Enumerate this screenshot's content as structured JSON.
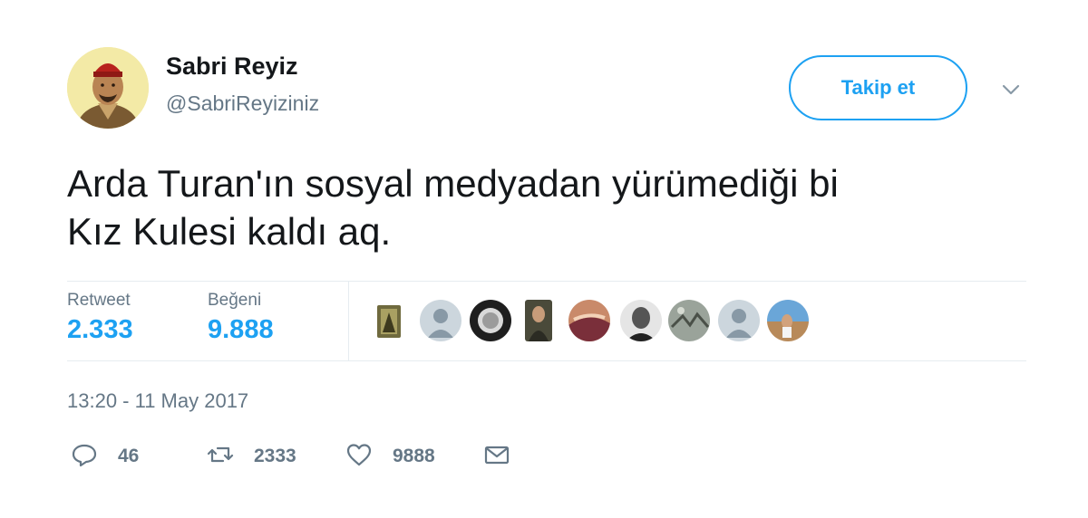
{
  "user": {
    "display_name": "Sabri Reyiz",
    "handle": "@SabriReyiziniz"
  },
  "follow_label": "Takip et",
  "tweet": {
    "text": "Arda Turan'ın sosyal medyadan yürümediği bi\nKız Kulesi kaldı aq."
  },
  "stats": {
    "retweets_label": "Retweet",
    "retweets_value": "2.333",
    "likes_label": "Beğeni",
    "likes_value": "9.888"
  },
  "timestamp": "13:20 - 11 May 2017",
  "actions": {
    "reply_count": "46",
    "retweet_count": "2333",
    "like_count": "9888"
  },
  "colors": {
    "accent": "#1da1f2",
    "secondary_text": "#657786",
    "divider": "#e6ecf0"
  }
}
